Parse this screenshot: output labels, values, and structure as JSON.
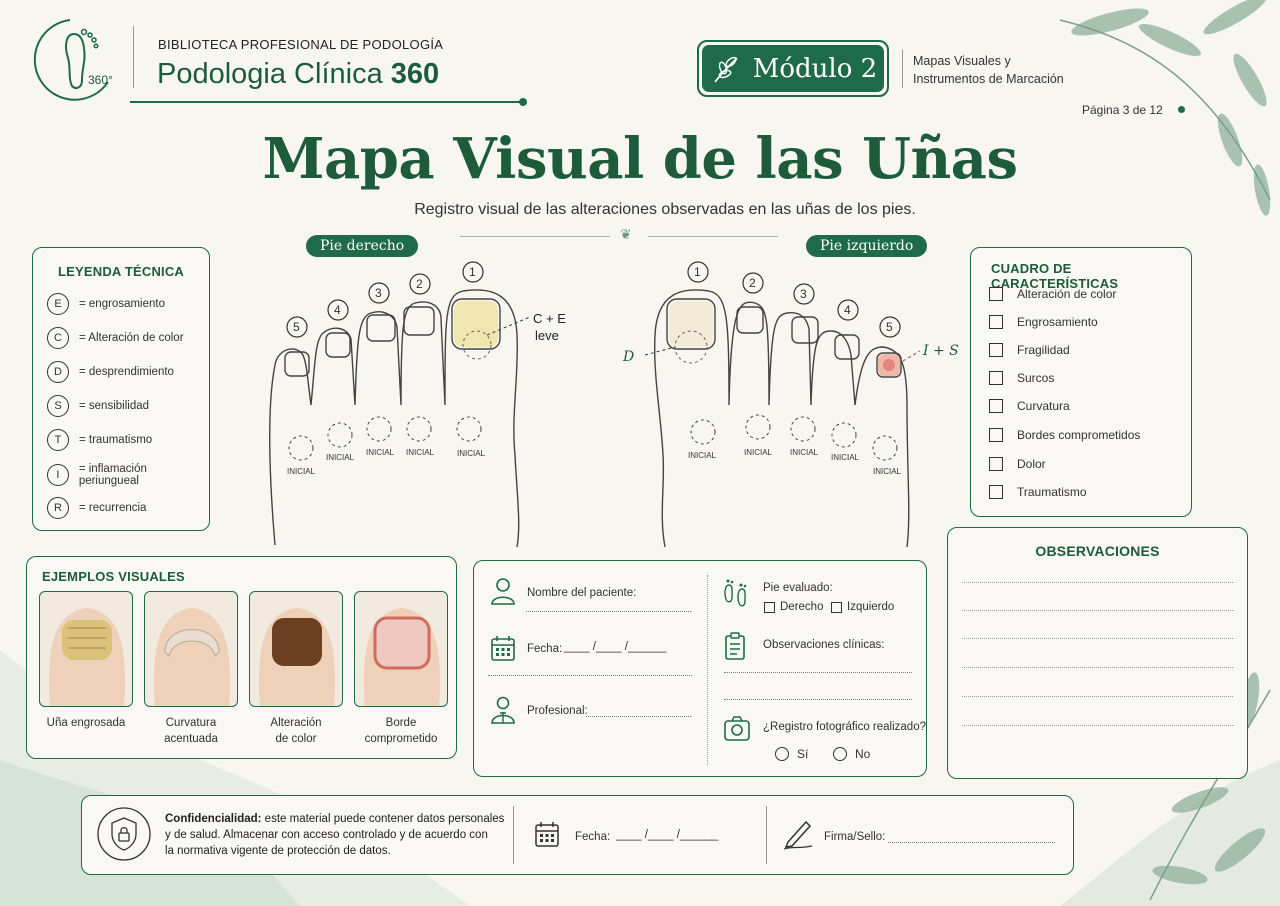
{
  "header": {
    "library": "BIBLIOTECA PROFESIONAL DE PODOLOGÍA",
    "brand_main": "Podologia Clínica",
    "brand_num": "360",
    "logo_text": "360°",
    "module": "Módulo 2",
    "module_desc_1": "Mapas Visuales y",
    "module_desc_2": "Instrumentos de Marcación",
    "page": "Página 3 de 12"
  },
  "title": "Mapa Visual de las Uñas",
  "subtitle": "Registro visual de las alteraciones observadas en las uñas de los pies.",
  "feet": {
    "right_label": "Pie derecho",
    "left_label": "Pie izquierdo",
    "initial": "INICIAL",
    "right_annotation_1": "C + E",
    "right_annotation_2": "leve",
    "left_annotation_d": "D",
    "left_annotation_is": "I + S",
    "toe_numbers": [
      "1",
      "2",
      "3",
      "4",
      "5"
    ]
  },
  "legend": {
    "title": "LEYENDA TÉCNICA",
    "items": [
      {
        "code": "E",
        "text": "= engrosamiento"
      },
      {
        "code": "C",
        "text": "= Alteración de color"
      },
      {
        "code": "D",
        "text": "= desprendimiento"
      },
      {
        "code": "S",
        "text": "= sensibilidad"
      },
      {
        "code": "T",
        "text": "= traumatismo"
      },
      {
        "code": "I",
        "text": "= inflamación periungueal"
      },
      {
        "code": "R",
        "text": "= recurrencia"
      }
    ]
  },
  "features": {
    "title": "CUADRO DE CARACTERÍSTICAS",
    "items": [
      "Alteración de color",
      "Engrosamiento",
      "Fragilidad",
      "Surcos",
      "Curvatura",
      "Bordes comprometidos",
      "Dolor",
      "Traumatismo"
    ]
  },
  "examples": {
    "title": "EJEMPLOS VISUALES",
    "items": [
      {
        "l1": "Uña engrosada",
        "l2": "",
        "color": "#d9c27a"
      },
      {
        "l1": "Curvatura acentuada",
        "l2": "",
        "color": "#e8ddd0"
      },
      {
        "l1": "Alteración",
        "l2": "de color",
        "color": "#6b3f20"
      },
      {
        "l1": "Borde",
        "l2": "comprometido",
        "color": "#efc9c0"
      }
    ]
  },
  "form": {
    "patient": "Nombre del paciente:",
    "date": "Fecha:",
    "date_blank": "____ /____ /______",
    "professional": "Profesional:",
    "foot_eval": "Pie evaluado:",
    "right": "Derecho",
    "left": "Izquierdo",
    "clinical_obs": "Observaciones clínicas:",
    "photo_q": "¿Registro fotográfico realizado?",
    "yes": "Sí",
    "no": "No"
  },
  "observations": {
    "title": "OBSERVACIONES"
  },
  "footer": {
    "conf_bold": "Confidencialidad:",
    "conf_1": " este material puede contener datos personales",
    "conf_2": "y de salud. Almacenar con acceso controlado y de acuerdo con",
    "conf_3": "la normativa vigente de protección de datos.",
    "date": "Fecha:",
    "date_blank": "____ /____ /______",
    "sign": "Firma/Sello:"
  },
  "colors": {
    "accent": "#1f6a48",
    "background": "#f7f6f1"
  }
}
